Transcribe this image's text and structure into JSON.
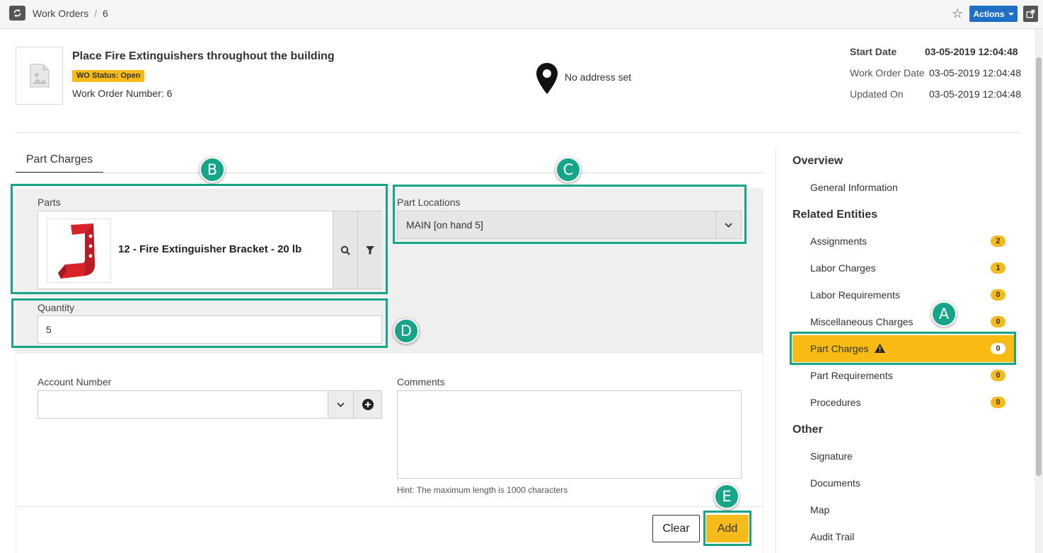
{
  "header": {
    "breadcrumb": [
      "Work Orders",
      "6"
    ],
    "actions_label": "Actions"
  },
  "work_order": {
    "title": "Place Fire Extinguishers throughout the building",
    "status": "WO Status: Open",
    "number_label": "Work Order Number:",
    "number": "6",
    "address": "No address set",
    "meta": [
      {
        "label": "Start Date",
        "value": "03-05-2019 12:04:48",
        "bold": true
      },
      {
        "label": "Work Order Date",
        "value": "03-05-2019 12:04:48",
        "bold": false
      },
      {
        "label": "Updated On",
        "value": "03-05-2019 12:04:48",
        "bold": false
      }
    ]
  },
  "form": {
    "tab_label": "Part Charges",
    "parts_label": "Parts",
    "part_name": "12 - Fire Extinguisher Bracket - 20 lb",
    "part_locations_label": "Part Locations",
    "part_location_value": "MAIN [on hand 5]",
    "quantity_label": "Quantity",
    "quantity_value": "5",
    "account_label": "Account Number",
    "account_value": "",
    "comments_label": "Comments",
    "comments_value": "",
    "hint": "Hint: The maximum length is 1000 characters",
    "clear_label": "Clear",
    "add_label": "Add"
  },
  "sidebar": {
    "overview_heading": "Overview",
    "overview_items": [
      {
        "label": "General Information"
      }
    ],
    "related_heading": "Related Entities",
    "related_items": [
      {
        "label": "Assignments",
        "count": "2"
      },
      {
        "label": "Labor Charges",
        "count": "1"
      },
      {
        "label": "Labor Requirements",
        "count": "0"
      },
      {
        "label": "Miscellaneous Charges",
        "count": "0"
      },
      {
        "label": "Part Charges",
        "count": "0",
        "active": true
      },
      {
        "label": "Part Requirements",
        "count": "0"
      },
      {
        "label": "Procedures",
        "count": "0"
      }
    ],
    "other_heading": "Other",
    "other_items": [
      {
        "label": "Signature"
      },
      {
        "label": "Documents"
      },
      {
        "label": "Map"
      },
      {
        "label": "Audit Trail"
      }
    ]
  },
  "annotations": {
    "A": "A",
    "B": "B",
    "C": "C",
    "D": "D",
    "E": "E"
  },
  "colors": {
    "accent_yellow": "#f6bb1a",
    "primary_blue": "#1f6fc5",
    "callout_green": "#17a589"
  }
}
